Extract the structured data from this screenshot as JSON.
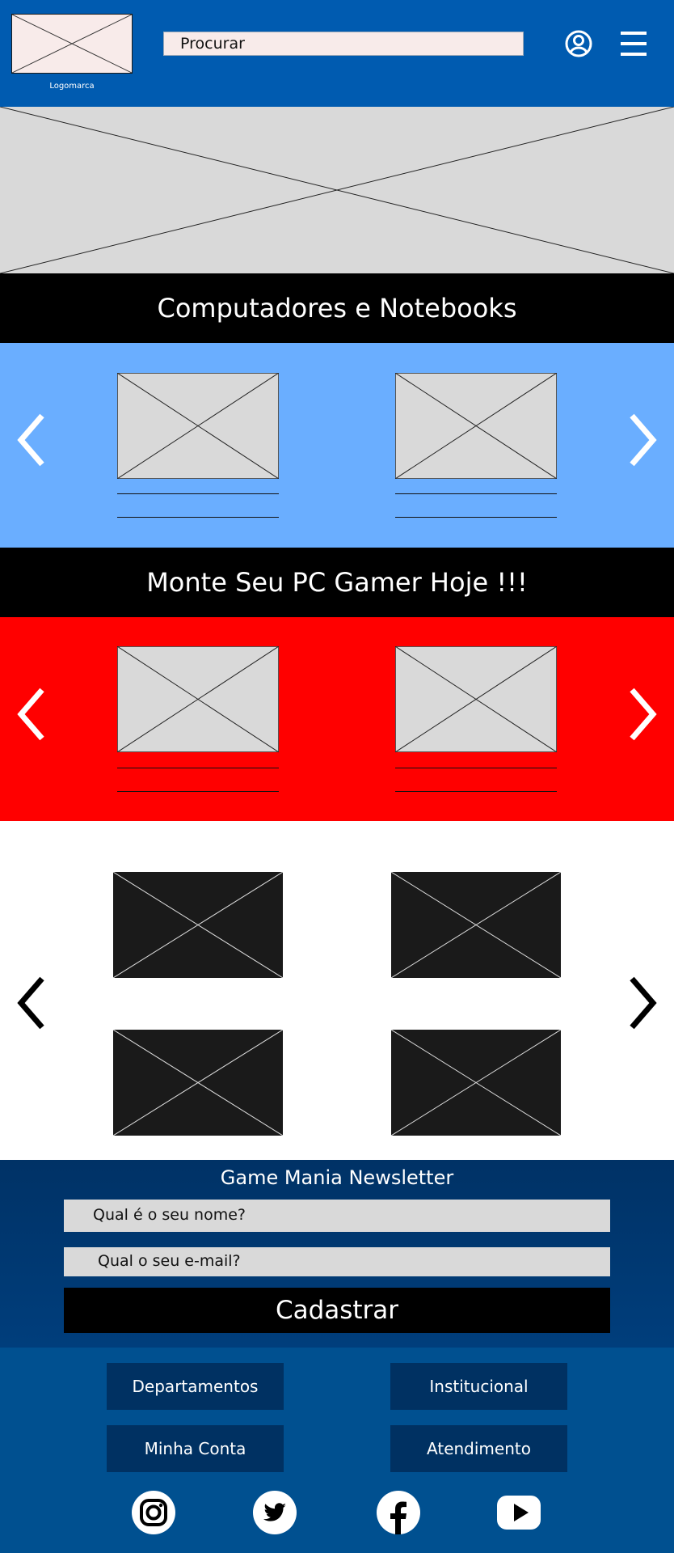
{
  "header": {
    "logo_caption": "Logomarca",
    "search_placeholder": "Procurar",
    "user_icon": "user-circle-icon",
    "menu_icon": "hamburger-menu-icon"
  },
  "sections": {
    "computers_title": "Computadores e Notebooks",
    "gamer_title": "Monte Seu PC Gamer Hoje !!!"
  },
  "newsletter": {
    "title": "Game Mania Newsletter",
    "name_placeholder": "Qual é o seu nome?",
    "email_placeholder": "Qual o seu e-mail?",
    "submit_label": "Cadastrar"
  },
  "footer": {
    "links": [
      "Departamentos",
      "Institucional",
      "Minha Conta",
      "Atendimento"
    ],
    "social_icons": [
      "instagram-icon",
      "twitter-icon",
      "facebook-icon",
      "youtube-icon"
    ]
  },
  "colors": {
    "header_bg": "#005bb0",
    "computers_bg": "#6aaeff",
    "gamer_bg": "#ff0000",
    "newsletter_bg": "#003266",
    "footer_bg": "#005090",
    "footer_button_bg": "#003162"
  }
}
